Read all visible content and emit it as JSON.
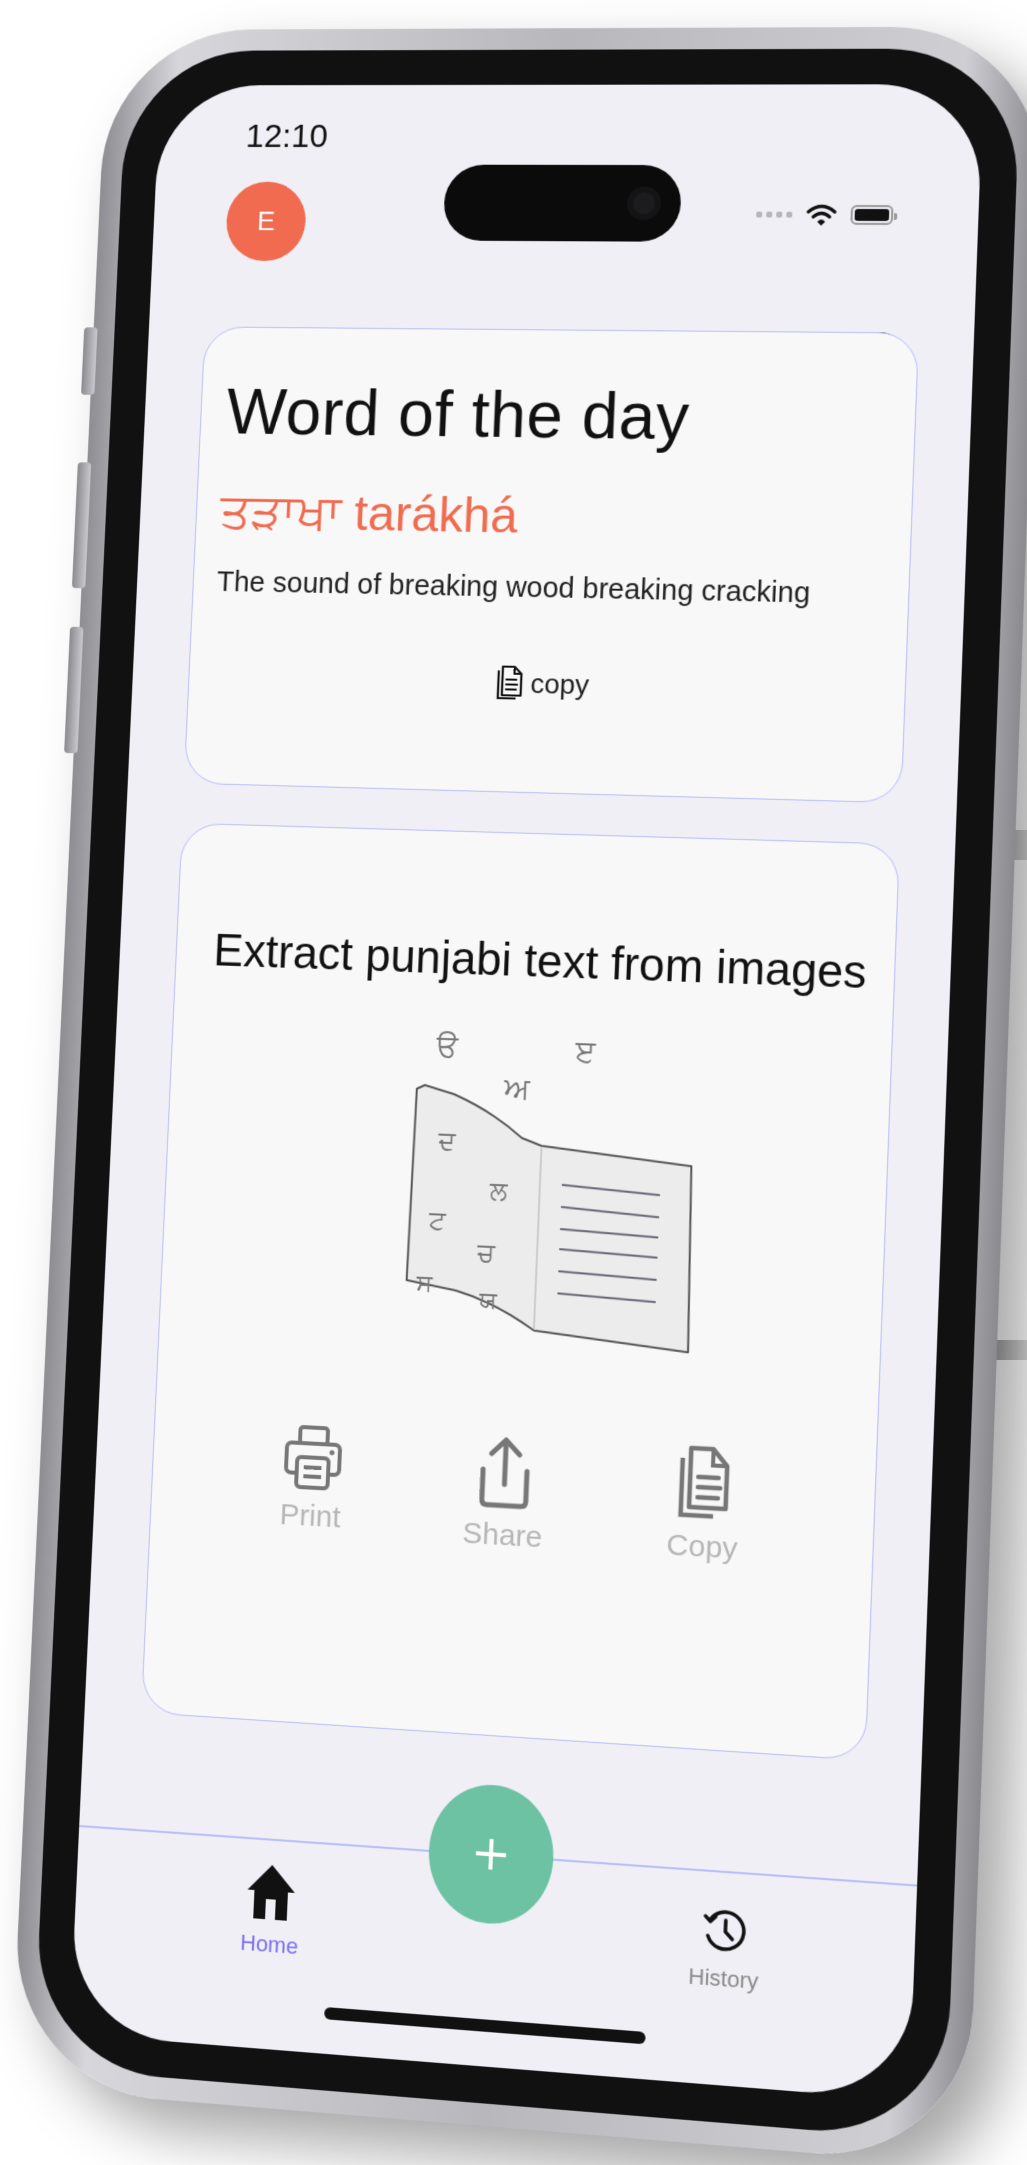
{
  "status_bar": {
    "time": "12:10",
    "icons": [
      "signal-dots-icon",
      "wifi-icon",
      "battery-icon"
    ]
  },
  "header": {
    "avatar_initial": "E",
    "help_icon": "question-mark-icon",
    "help_symbol": "?"
  },
  "word_of_day": {
    "title": "Word of the day",
    "term": "ਤੜਾਖਾ tarákhá",
    "definition": "The sound of breaking wood breaking cracking",
    "copy_label": "copy",
    "copy_icon": "copy-document-icon"
  },
  "extract": {
    "title": "Extract punjabi text from images",
    "illustration_letters": [
      "ੳ",
      "ੲ",
      "ਅ",
      "ਦ",
      "ਲ",
      "ਟ",
      "ਚ",
      "ਸ",
      "ਯ"
    ],
    "actions": [
      {
        "label": "Print",
        "icon": "printer-icon"
      },
      {
        "label": "Share",
        "icon": "share-icon"
      },
      {
        "label": "Copy",
        "icon": "copy-document-icon"
      }
    ]
  },
  "bottom_nav": {
    "items": [
      {
        "label": "Home",
        "icon": "home-icon",
        "active": true
      },
      {
        "label": "History",
        "icon": "history-clock-icon",
        "active": false
      }
    ],
    "fab_symbol": "+",
    "fab_icon": "plus-icon"
  },
  "colors": {
    "accent": "#f06b4f",
    "fab": "#6cc2a3",
    "nav_active": "#7a6ff0",
    "card_border": "#b8bdfb",
    "screen_bg": "#f0eff5"
  }
}
